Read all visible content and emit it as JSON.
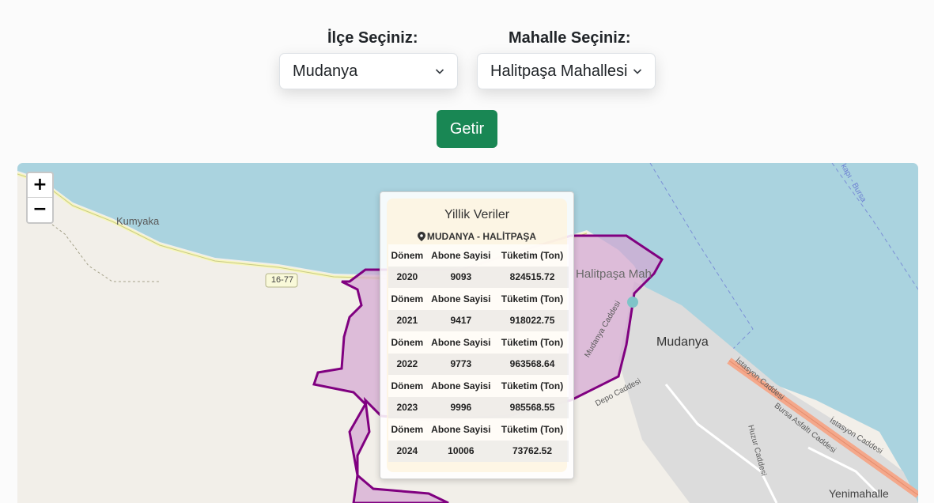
{
  "filters": {
    "district_label": "İlçe Seçiniz:",
    "district_value": "Mudanya",
    "neighborhood_label": "Mahalle Seçiniz:",
    "neighborhood_value": "Halitpaşa Mahallesi",
    "submit_label": "Getir"
  },
  "map": {
    "zoom_in": "+",
    "zoom_out": "−",
    "labels": {
      "kumyaka": "Kumyaka",
      "road_16_77": "16-77",
      "halitpasa": "Halitpaşa Mah",
      "mudanya": "Mudanya",
      "yenimahalle": "Yenimahalle",
      "istasyon_caddesi": "İstasyon Caddesi",
      "istasyon_caddesi_2": "İstasyon Caddesi",
      "bursa_asfalti": "Bursa Asfaltı Caddesi",
      "huzur_caddesi": "Huzur Caddesi",
      "mudanya_caddesi": "Mudanya Caddesi",
      "depo_caddesi": "Depo Caddesi",
      "kapi_bursa": "kapı - Bursa"
    },
    "colors": {
      "water": "#aad3df",
      "land": "#f2efe9",
      "polygon_stroke": "#800080",
      "polygon_fill": "#d4a7d1"
    }
  },
  "popup": {
    "title": "Yillik Veriler",
    "location_icon": "map-pin-icon",
    "location": "MUDANYA - HALİTPAŞA",
    "headers": [
      "Dönem",
      "Abone Sayisi",
      "Tüketim (Ton)"
    ],
    "rows": [
      {
        "period": "2020",
        "subscribers": "9093",
        "consumption": "824515.72"
      },
      {
        "period": "2021",
        "subscribers": "9417",
        "consumption": "918022.75"
      },
      {
        "period": "2022",
        "subscribers": "9773",
        "consumption": "963568.64"
      },
      {
        "period": "2023",
        "subscribers": "9996",
        "consumption": "985568.55"
      },
      {
        "period": "2024",
        "subscribers": "10006",
        "consumption": "73762.52"
      }
    ]
  }
}
